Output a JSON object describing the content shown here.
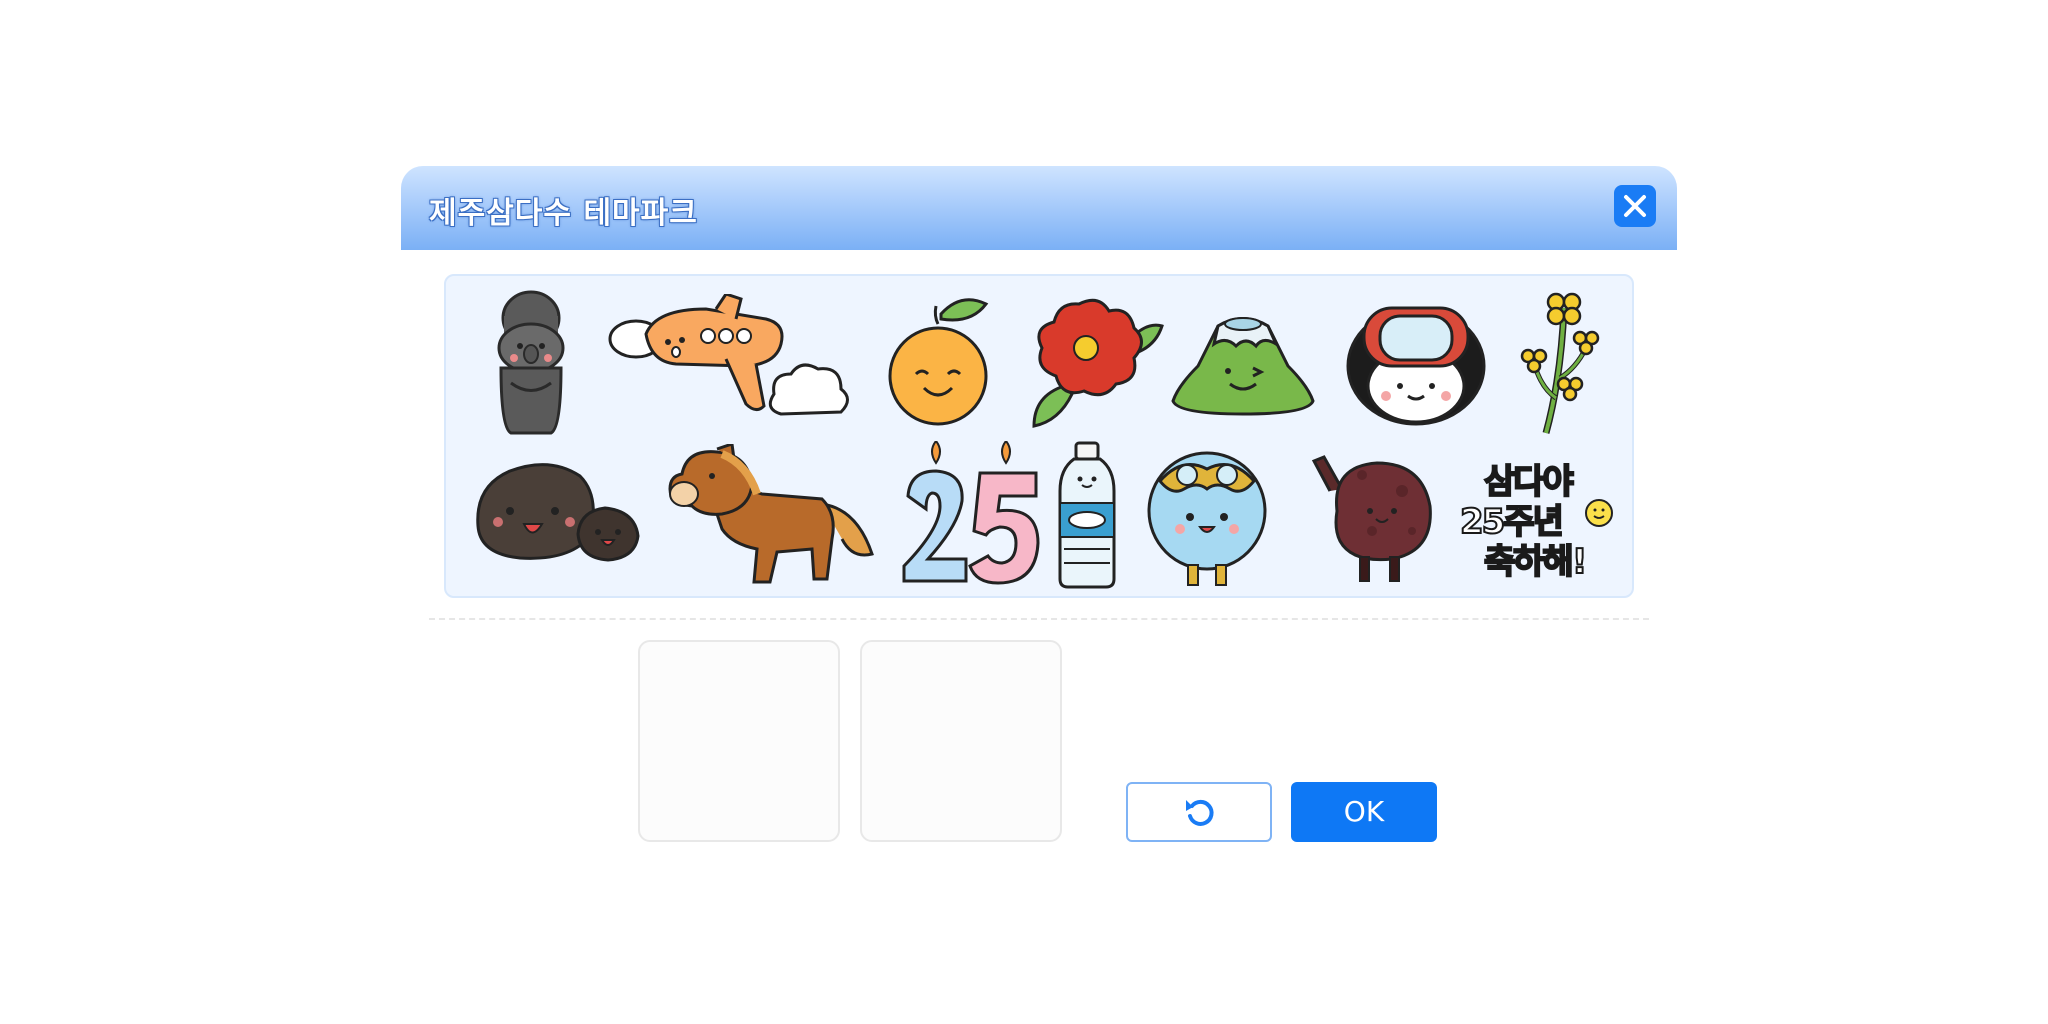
{
  "dialog": {
    "title": "제주삼다수 테마파크",
    "close_icon": "close-icon"
  },
  "stickers": [
    {
      "name": "dol-hareubang"
    },
    {
      "name": "airplane"
    },
    {
      "name": "tangerine"
    },
    {
      "name": "camellia-flower"
    },
    {
      "name": "hallasan-mountain"
    },
    {
      "name": "diver-girl"
    },
    {
      "name": "canola-flower"
    },
    {
      "name": "basalt-rocks"
    },
    {
      "name": "jeju-horse"
    },
    {
      "name": "candles-25"
    },
    {
      "name": "water-bottle"
    },
    {
      "name": "water-drop-character"
    },
    {
      "name": "volcanic-stone-character"
    },
    {
      "name": "anniversary-text",
      "text_line1": "삼다야",
      "text_line2": "25주년",
      "text_line3": "축하해!"
    }
  ],
  "slots": [
    {
      "label": ""
    },
    {
      "label": ""
    }
  ],
  "actions": {
    "reset_icon": "reset-icon",
    "ok_label": "OK"
  },
  "colors": {
    "accent": "#0e78f5",
    "title_gradient_top": "#cfe4ff",
    "title_gradient_bottom": "#7bb0f5",
    "panel_bg": "#eef5ff"
  }
}
